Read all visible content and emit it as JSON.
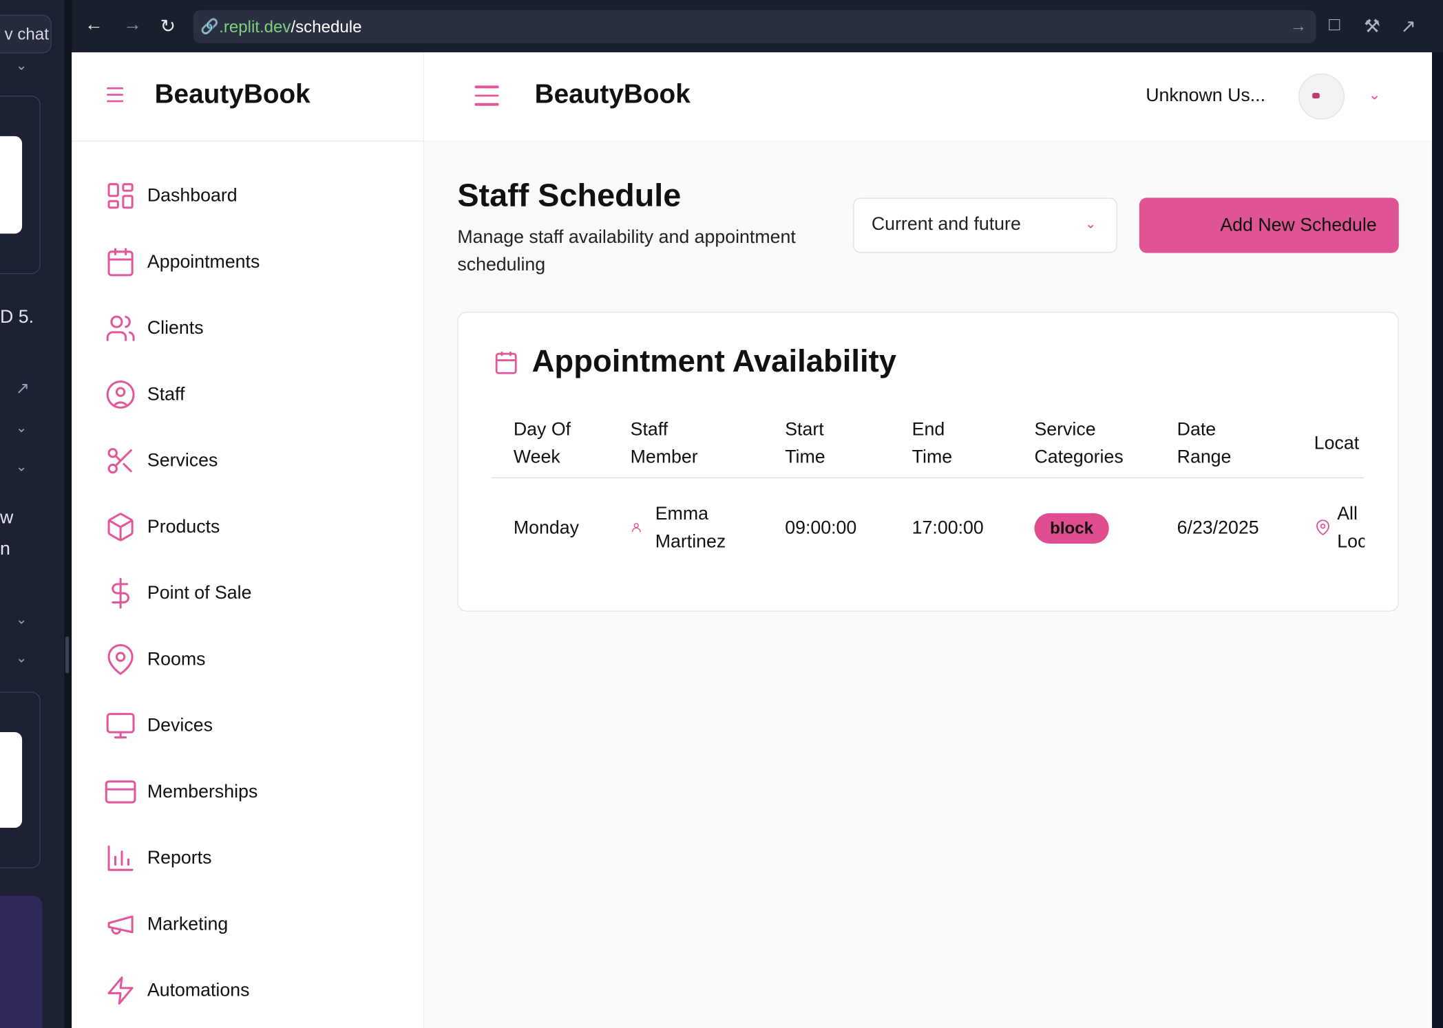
{
  "left_panel": {
    "chat_button": "v chat",
    "text_1": "D 5.",
    "text_2": "w",
    "text_3": "n"
  },
  "browser": {
    "url_domain": ".replit.dev",
    "url_path": "/schedule"
  },
  "sidebar": {
    "brand": "BeautyBook",
    "items": [
      {
        "label": "Dashboard",
        "icon": "dashboard-icon"
      },
      {
        "label": "Appointments",
        "icon": "calendar-icon"
      },
      {
        "label": "Clients",
        "icon": "users-icon"
      },
      {
        "label": "Staff",
        "icon": "user-circle-icon"
      },
      {
        "label": "Services",
        "icon": "scissors-icon"
      },
      {
        "label": "Products",
        "icon": "package-icon"
      },
      {
        "label": "Point of Sale",
        "icon": "dollar-icon"
      },
      {
        "label": "Rooms",
        "icon": "map-pin-icon"
      },
      {
        "label": "Devices",
        "icon": "monitor-icon"
      },
      {
        "label": "Memberships",
        "icon": "credit-card-icon"
      },
      {
        "label": "Reports",
        "icon": "bar-chart-icon"
      },
      {
        "label": "Marketing",
        "icon": "megaphone-icon"
      },
      {
        "label": "Automations",
        "icon": "zap-icon"
      }
    ]
  },
  "header": {
    "brand": "BeautyBook",
    "user_name": "Unknown Us..."
  },
  "page": {
    "title": "Staff Schedule",
    "subtitle": "Manage staff availability and appointment scheduling",
    "filter_value": "Current and future",
    "add_button": "Add New Schedule"
  },
  "availability": {
    "title": "Appointment Availability",
    "columns": {
      "day": [
        "Day Of",
        "Week"
      ],
      "staff": [
        "Staff",
        "Member"
      ],
      "start": [
        "Start",
        "Time"
      ],
      "end": [
        "End",
        "Time"
      ],
      "service": [
        "Service",
        "Categories"
      ],
      "range": [
        "Date",
        "Range"
      ],
      "location": "Locat"
    },
    "rows": [
      {
        "day": "Monday",
        "staff": [
          "Emma",
          "Martinez"
        ],
        "start": "09:00:00",
        "end": "17:00:00",
        "category": "block",
        "range": "6/23/2025",
        "location": [
          "All",
          "Loc"
        ]
      }
    ]
  },
  "colors": {
    "accent": "#df5593",
    "dark_bg": "#1a1f2e"
  }
}
